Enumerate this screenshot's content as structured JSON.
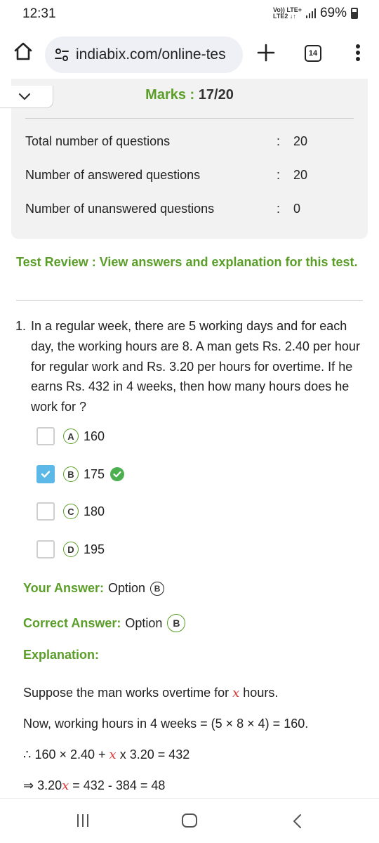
{
  "status_bar": {
    "time": "12:31",
    "network_top": "Vo)) LTE+",
    "network_bottom": "LTE2 ↓↑",
    "battery": "69%"
  },
  "browser": {
    "url": "indiabix.com/online-tes",
    "tab_count": "14"
  },
  "summary": {
    "marks_label": "Marks : ",
    "marks_value": "17/20",
    "rows": [
      {
        "label": "Total number of questions",
        "colon": ":",
        "value": "20"
      },
      {
        "label": "Number of answered questions",
        "colon": ":",
        "value": "20"
      },
      {
        "label": "Number of unanswered questions",
        "colon": ":",
        "value": "0"
      }
    ]
  },
  "review_heading": "Test Review : View answers and explanation for this test.",
  "question": {
    "number": "1.",
    "text": "In a regular week, there are 5 working days and for each day, the working hours are 8. A man gets Rs. 2.40 per hour for regular work and Rs. 3.20 per hours for overtime. If he earns Rs. 432 in 4 weeks, then how many hours does he work for ?",
    "options": [
      {
        "letter": "A",
        "text": "160",
        "checked": false
      },
      {
        "letter": "B",
        "text": "175",
        "checked": true
      },
      {
        "letter": "C",
        "text": "180",
        "checked": false
      },
      {
        "letter": "D",
        "text": "195",
        "checked": false
      }
    ]
  },
  "your_answer": {
    "label": "Your Answer:",
    "prefix": "Option",
    "letter": "B"
  },
  "correct_answer": {
    "label": "Correct Answer:",
    "prefix": "Option",
    "letter": "B"
  },
  "explanation": {
    "label": "Explanation:",
    "line1_a": "Suppose the man works overtime for ",
    "line1_var": "x",
    "line1_b": " hours.",
    "line2": "Now, working hours in 4 weeks = (5 × 8 × 4) = 160.",
    "line3_a": "∴ 160 × 2.40 + ",
    "line3_var": "x",
    "line3_b": " x 3.20 = 432",
    "line4_a": "⇒ 3.20",
    "line4_var": "x",
    "line4_b": " = 432 - 384 = 48"
  },
  "colors": {
    "accent_green": "#5a9e28",
    "checkbox_blue": "#5cb8e6",
    "correct_tick": "#4caf50"
  }
}
